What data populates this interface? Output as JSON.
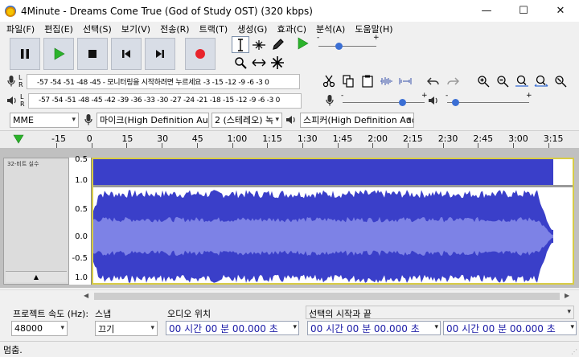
{
  "window": {
    "title": "4Minute - Dreams Come True (God of Study OST) (320  kbps)",
    "minimize": "—",
    "maximize": "☐",
    "close": "✕"
  },
  "menu": [
    "파일(F)",
    "편집(E)",
    "선택(S)",
    "보기(V)",
    "전송(R)",
    "트랙(T)",
    "생성(G)",
    "효과(C)",
    "분석(A)",
    "도움말(H)"
  ],
  "meters": {
    "record_scale": "-57 -54 -51 -48 -45 -  모니터링을 시작하려면 누르세요  -3 -15 -12 -9  -6  -3  0",
    "play_scale": "-57 -54 -51 -48 -45 -42 -39 -36 -33 -30 -27 -24 -21 -18 -15 -12  -9  -6  -3  0",
    "lr_top": "L R",
    "lr_bottom": "L R",
    "record_gain_minus": "-",
    "record_gain_plus": "+",
    "play_gain_minus": "-",
    "play_gain_plus": "+",
    "play_speed_minus": "-",
    "play_speed_plus": "+"
  },
  "devices": {
    "host": "MME",
    "recording_device": "마이크(High Definition Aud",
    "channels": "2 (스테레오) 녹",
    "playback_device": "스피커(High Definition Aud"
  },
  "timeline": {
    "ticks": [
      "-15",
      "0",
      "15",
      "30",
      "45",
      "1:00",
      "1:15",
      "1:30",
      "1:45",
      "2:00",
      "2:15",
      "2:30",
      "2:45",
      "3:00",
      "3:15"
    ]
  },
  "track": {
    "name_label": "32-비트 실수",
    "scale": [
      "0.5",
      "1.0",
      "0.5",
      "0.0",
      "-0.5",
      "1.0"
    ],
    "collapse_glyph": "▲"
  },
  "selection_toolbar": {
    "rate_label": "프로젝트 속도 (Hz):",
    "rate_value": "48000",
    "snap_label": "스냅",
    "snap_value": "끄기",
    "position_label": "오디오 위치",
    "position_value": "00 시간 00 분 00.000 초",
    "selection_label": "선택의 시작과 끝",
    "selection_start": "00 시간 00 분 00.000 초",
    "selection_end": "00 시간 00 분 00.000 초"
  },
  "status": {
    "text": "멈춤."
  },
  "colors": {
    "wave": "#3a3fc9",
    "wave_light": "#7d82e6",
    "selection_border": "#d8cc45",
    "record_red": "#e8242c",
    "play_green": "#2bb32b"
  }
}
